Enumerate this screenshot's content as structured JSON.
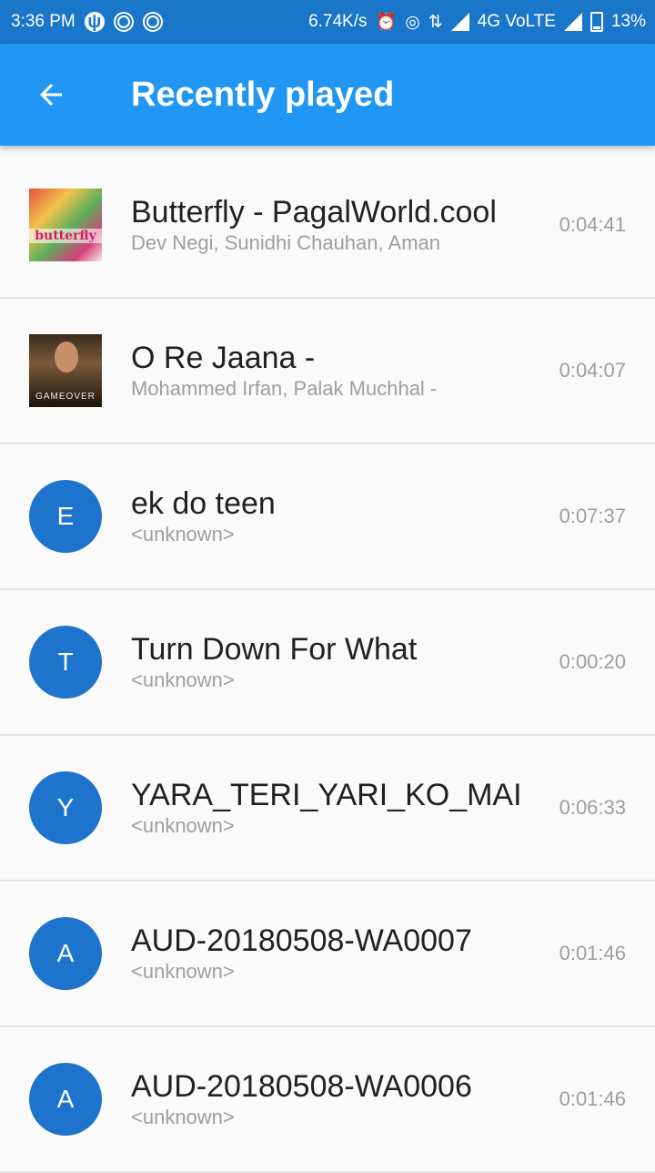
{
  "status_bar": {
    "time": "3:36 PM",
    "net_speed": "6.74K/s",
    "network": "4G VoLTE",
    "battery": "13%",
    "icons": [
      "usb-icon",
      "notification-icon",
      "notification-icon",
      "alarm-icon",
      "hotspot-icon",
      "data-arrows-icon",
      "signal-icon",
      "signal-icon",
      "battery-icon"
    ]
  },
  "app_bar": {
    "title": "Recently played",
    "back_icon": "arrow-left-icon",
    "background": "#2196f3"
  },
  "tracks": [
    {
      "title": "Butterfly - PagalWorld.cool",
      "subtitle": "Dev Negi, Sunidhi Chauhan, Aman",
      "duration": "0:04:41",
      "art": "butterfly",
      "art_text": "butterfly"
    },
    {
      "title": "O Re Jaana -",
      "subtitle": "Mohammed Irfan, Palak Muchhal -",
      "duration": "0:04:07",
      "art": "ore",
      "art_text": "GAMEOVER"
    },
    {
      "title": "ek do teen",
      "subtitle": "<unknown>",
      "duration": "0:07:37",
      "letter": "E"
    },
    {
      "title": "Turn Down For What",
      "subtitle": "<unknown>",
      "duration": "0:00:20",
      "letter": "T"
    },
    {
      "title": "YARA_TERI_YARI_KO_MAI",
      "subtitle": "<unknown>",
      "duration": "0:06:33",
      "letter": "Y"
    },
    {
      "title": "AUD-20180508-WA0007",
      "subtitle": "<unknown>",
      "duration": "0:01:46",
      "letter": "A"
    },
    {
      "title": "AUD-20180508-WA0006",
      "subtitle": "<unknown>",
      "duration": "0:01:46",
      "letter": "A"
    }
  ],
  "colors": {
    "status_bar": "#1a76c8",
    "avatar": "#1e74cc",
    "title_text": "#212121",
    "secondary_text": "#9e9e9e"
  }
}
